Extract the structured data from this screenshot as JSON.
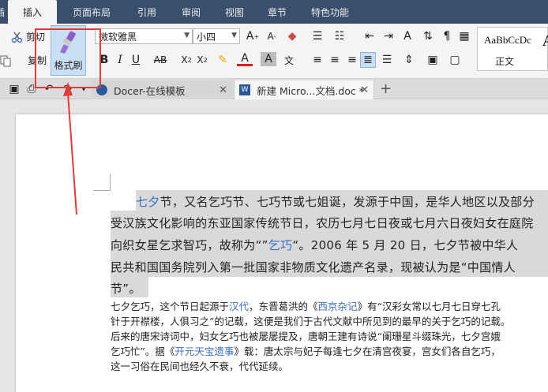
{
  "menu": {
    "tabs": [
      {
        "label": "插入",
        "active": true
      },
      {
        "label": "页面布局",
        "active": false
      },
      {
        "label": "引用",
        "active": false
      },
      {
        "label": "审阅",
        "active": false
      },
      {
        "label": "视图",
        "active": false
      },
      {
        "label": "章节",
        "active": false
      },
      {
        "label": "特色功能",
        "active": false
      }
    ],
    "clipped_left": "插"
  },
  "ribbon": {
    "cut_label": "剪切",
    "copy_label": "复制",
    "format_painter_label": "格式刷",
    "font_name": "微软雅黑",
    "font_size": "小四",
    "style_sample": "AaBbCcDc",
    "style_name": "正文",
    "style_sample2": "A"
  },
  "doc_tabs": [
    {
      "label": "Docer-在线模板",
      "active": false
    },
    {
      "label": "新建 Micro...文档.doc *",
      "active": true
    }
  ],
  "document": {
    "para1": [
      {
        "parts": [
          {
            "t": "七夕",
            "link": true
          },
          {
            "t": "节，又名乞巧节、七巧节或七姐诞，发源于中国，是华人地区以及部分"
          }
        ]
      },
      {
        "parts": [
          {
            "t": "受汉族文化影响的东亚国家传统节日，农历七月七日夜或七月六日夜妇女在庭院"
          }
        ]
      },
      {
        "parts": [
          {
            "t": "向织女星乞求智巧，故称为“”"
          },
          {
            "t": "乞巧",
            "link": true
          },
          {
            "t": "“。2006 年 5 月 20 日，七夕节被中华人"
          }
        ]
      },
      {
        "parts": [
          {
            "t": "民共和国国务院列入第一批国家非物质文化遗产名录，现被认为是“中国情人"
          }
        ]
      },
      {
        "parts": [
          {
            "t": "节”。"
          }
        ]
      }
    ],
    "para2": [
      {
        "parts": [
          {
            "t": "七夕乞巧，这个节日起源于"
          },
          {
            "t": "汉代",
            "link": true
          },
          {
            "t": "，东晋葛洪的《"
          },
          {
            "t": "西京杂记",
            "link": true
          },
          {
            "t": "》有“汉彩女常以七月七日穿七孔"
          }
        ]
      },
      {
        "parts": [
          {
            "t": "针于开襟楼，人俱习之”的记载，这便是我们于古代文献中所见到的最早的关于乞巧的记载。"
          }
        ]
      },
      {
        "parts": [
          {
            "t": "后来的唐宋诗词中，妇女乞巧也被屡屡提及，唐朝王建有诗说“阑珊星斗缀珠光，七夕宫娥"
          }
        ]
      },
      {
        "parts": [
          {
            "t": "乞巧忙”。据《"
          },
          {
            "t": "开元天宝遗事",
            "link": true
          },
          {
            "t": "》载：唐太宗与妃子每逢七夕在清宫夜宴，宫女们各自乞巧，"
          }
        ]
      },
      {
        "parts": [
          {
            "t": "这一习俗在民间也经久不衰，代代延续。"
          }
        ]
      }
    ]
  },
  "colors": {
    "menubar": "#3a4f6b",
    "link": "#3a6fc4",
    "highlight": "#d9d9d9",
    "annotation": "#e23b3b"
  }
}
